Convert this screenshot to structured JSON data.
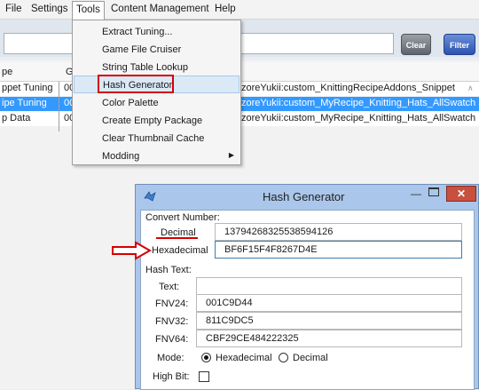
{
  "menubar": {
    "items": [
      "File",
      "Settings",
      "Tools",
      "Content Management",
      "Help"
    ]
  },
  "toolbar": {
    "search_value": "",
    "clear_label": "Clear",
    "filter_label": "Filter"
  },
  "grid": {
    "headers": [
      "pe",
      "G"
    ],
    "rows": [
      {
        "c0": "ppet Tuning",
        "c1": "00",
        "c2": "zoreYukii:custom_KnittingRecipeAddons_Snippet"
      },
      {
        "c0": "ipe Tuning",
        "c1": "00",
        "c2": "zoreYukii:custom_MyRecipe_Knitting_Hats_AllSwatch"
      },
      {
        "c0": "p Data",
        "c1": "00",
        "c2": "zoreYukii:custom_MyRecipe_Knitting_Hats_AllSwatch"
      }
    ]
  },
  "tools_menu": {
    "items": [
      "Extract Tuning...",
      "Game File Cruiser",
      "String Table Lookup",
      "Hash Generator",
      "Color Palette",
      "Create Empty Package",
      "Clear Thumbnail Cache",
      "Modding"
    ]
  },
  "dialog": {
    "title": "Hash Generator",
    "convert_number_label": "Convert Number:",
    "decimal_label": "Decimal",
    "decimal_value": "13794268325538594126",
    "hexadecimal_label": "Hexadecimal",
    "hexadecimal_value": "BF6F15F4F8267D4E",
    "hash_text_label": "Hash Text:",
    "text_label": "Text:",
    "text_value": "",
    "fnv24_label": "FNV24:",
    "fnv24_value": "001C9D44",
    "fnv32_label": "FNV32:",
    "fnv32_value": "811C9DC5",
    "fnv64_label": "FNV64:",
    "fnv64_value": "CBF29CE484222325",
    "mode_label": "Mode:",
    "mode_hex_label": "Hexadecimal",
    "mode_dec_label": "Decimal",
    "high_bit_label": "High Bit:"
  },
  "colors": {
    "selection": "#3399ff",
    "annotation_red": "#d40000",
    "dialog_frame": "#aac6ea"
  }
}
